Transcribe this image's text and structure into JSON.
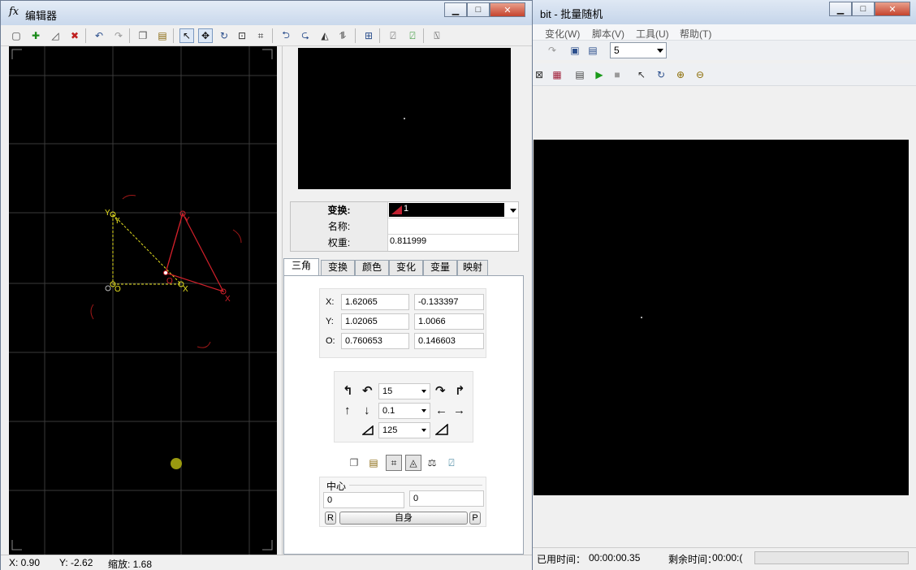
{
  "bg_window": {
    "title": "bit - 批量随机",
    "menu": [
      "变化(W)",
      "脚本(V)",
      "工具(U)",
      "帮助(T)"
    ],
    "combo_value": "5",
    "status_elapsed_label": "已用时间：",
    "status_elapsed": "00:00:00.35",
    "status_remaining_label": "剩余时间：",
    "status_remaining": "00:00:("
  },
  "editor": {
    "title": "编辑器",
    "fx_label": "fx",
    "transform_label": "变换:",
    "transform_value": "1",
    "name_label": "名称:",
    "name_value": "",
    "weight_label": "权重:",
    "weight_value": "0.811999",
    "tabs": [
      "三角",
      "变换",
      "颜色",
      "变化",
      "变量",
      "映射"
    ],
    "coords": {
      "x_label": "X:",
      "x1": "1.62065",
      "x2": "-0.133397",
      "y_label": "Y:",
      "y1": "1.02065",
      "y2": "1.0066",
      "o_label": "O:",
      "o1": "0.760653",
      "o2": "0.146603"
    },
    "rotate_value": "15",
    "move_value": "0.1",
    "scale_value": "125",
    "center_label": "中心",
    "center_x": "0",
    "center_y": "0",
    "btn_r": "R",
    "btn_self": "自身",
    "btn_p": "P",
    "status": {
      "x": "X: 0.90",
      "y": "Y: -2.62",
      "zoom": "缩放: 1.68"
    },
    "canvas_labels": {
      "y_yellow": "Y",
      "x_yellow": "X",
      "o_yellow": "O",
      "y_red": "Y",
      "x_red": "X",
      "o_red": "O"
    }
  },
  "colors": {
    "triangle_red": "#d0202a",
    "triangle_yellow": "#e6e020",
    "grid": "#3a3a3a"
  }
}
